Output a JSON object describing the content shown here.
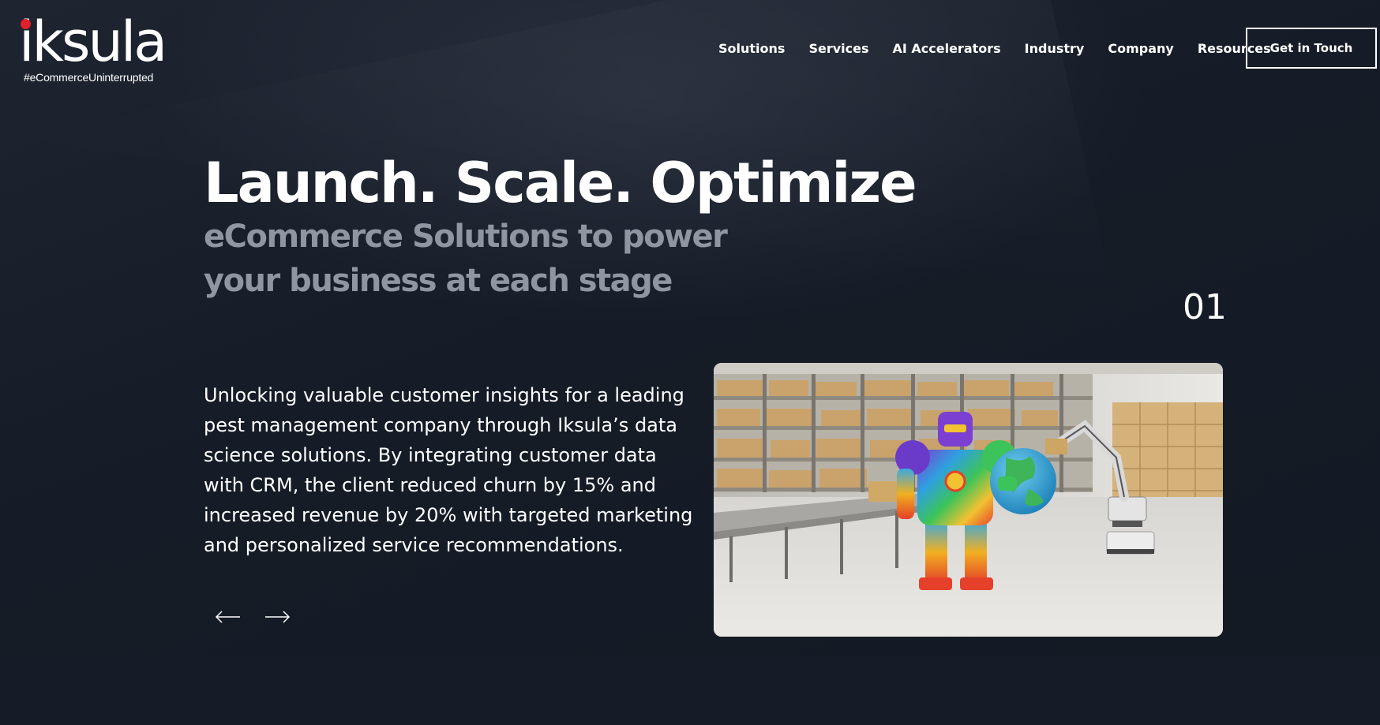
{
  "brand": {
    "name": "iksula",
    "tagline": "#eCommerceUninterrupted",
    "dot_color": "#e0202c"
  },
  "nav": {
    "items": [
      {
        "label": "Solutions"
      },
      {
        "label": "Services"
      },
      {
        "label": "AI Accelerators"
      },
      {
        "label": "Industry"
      },
      {
        "label": "Company"
      },
      {
        "label": "Resources"
      }
    ],
    "cta_label": "Get in Touch"
  },
  "hero": {
    "title": "Launch. Scale. Optimize",
    "subtitle": "eCommerce Solutions to power your business at each stage",
    "slide_number": "01",
    "description": "Unlocking valuable customer insights for a leading pest management company through Iksula’s data science solutions. By integrating customer data with CRM, the client reduced churn by 15% and increased revenue by 20% with targeted marketing and personalized service recommendations."
  },
  "carousel": {
    "prev_icon": "arrow-left-icon",
    "next_icon": "arrow-right-icon"
  },
  "colors": {
    "background": "#161c27",
    "subtitle": "#8f96a1",
    "text": "#ffffff"
  }
}
